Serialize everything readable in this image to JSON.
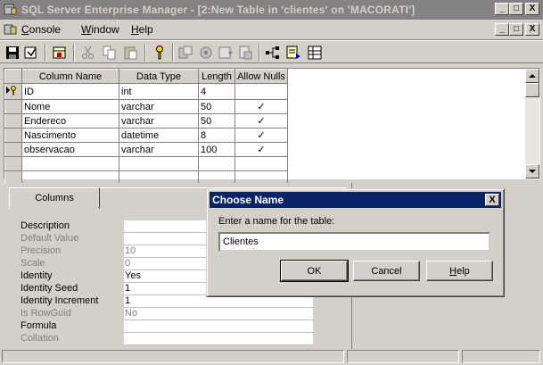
{
  "window": {
    "title": "SQL Server Enterprise Manager - [2:New Table in 'clientes' on 'MACORATI']",
    "min_glyph": "_",
    "max_glyph": "□",
    "close_glyph": "X"
  },
  "menubar": {
    "items": [
      {
        "hot": "C",
        "rest": "onsole"
      },
      {
        "hot": "W",
        "rest": "indow"
      },
      {
        "hot": "H",
        "rest": "elp"
      }
    ]
  },
  "grid": {
    "headers": [
      "Column Name",
      "Data Type",
      "Length",
      "Allow Nulls"
    ],
    "rows": [
      {
        "name": "ID",
        "type": "int",
        "length": "4",
        "nulls": ""
      },
      {
        "name": "Nome",
        "type": "varchar",
        "length": "50",
        "nulls": "✓"
      },
      {
        "name": "Endereco",
        "type": "varchar",
        "length": "50",
        "nulls": "✓"
      },
      {
        "name": "Nascimento",
        "type": "datetime",
        "length": "8",
        "nulls": "✓"
      },
      {
        "name": "observacao",
        "type": "varchar",
        "length": "100",
        "nulls": "✓"
      }
    ]
  },
  "tabs": {
    "columns": "Columns"
  },
  "properties": [
    {
      "label": "Description",
      "value": "",
      "dim": false
    },
    {
      "label": "Default Value",
      "value": "",
      "dim": true
    },
    {
      "label": "Precision",
      "value": "10",
      "dim": true
    },
    {
      "label": "Scale",
      "value": "0",
      "dim": true
    },
    {
      "label": "Identity",
      "value": "Yes",
      "dim": false
    },
    {
      "label": "Identity Seed",
      "value": "1",
      "dim": false
    },
    {
      "label": "Identity Increment",
      "value": "1",
      "dim": false
    },
    {
      "label": "Is RowGuid",
      "value": "No",
      "dim": true
    },
    {
      "label": "Formula",
      "value": "",
      "dim": false
    },
    {
      "label": "Collation",
      "value": "",
      "dim": true
    }
  ],
  "dialog": {
    "title": "Choose Name",
    "close_glyph": "X",
    "prompt": "Enter a name for the table:",
    "input_value": "Clientes",
    "ok": "OK",
    "cancel": "Cancel",
    "help_hot": "H",
    "help_rest": "elp"
  },
  "colors": {
    "title_inactive": "#848284",
    "dialog_title": "#0a246a",
    "face": "#d4d0c8"
  }
}
